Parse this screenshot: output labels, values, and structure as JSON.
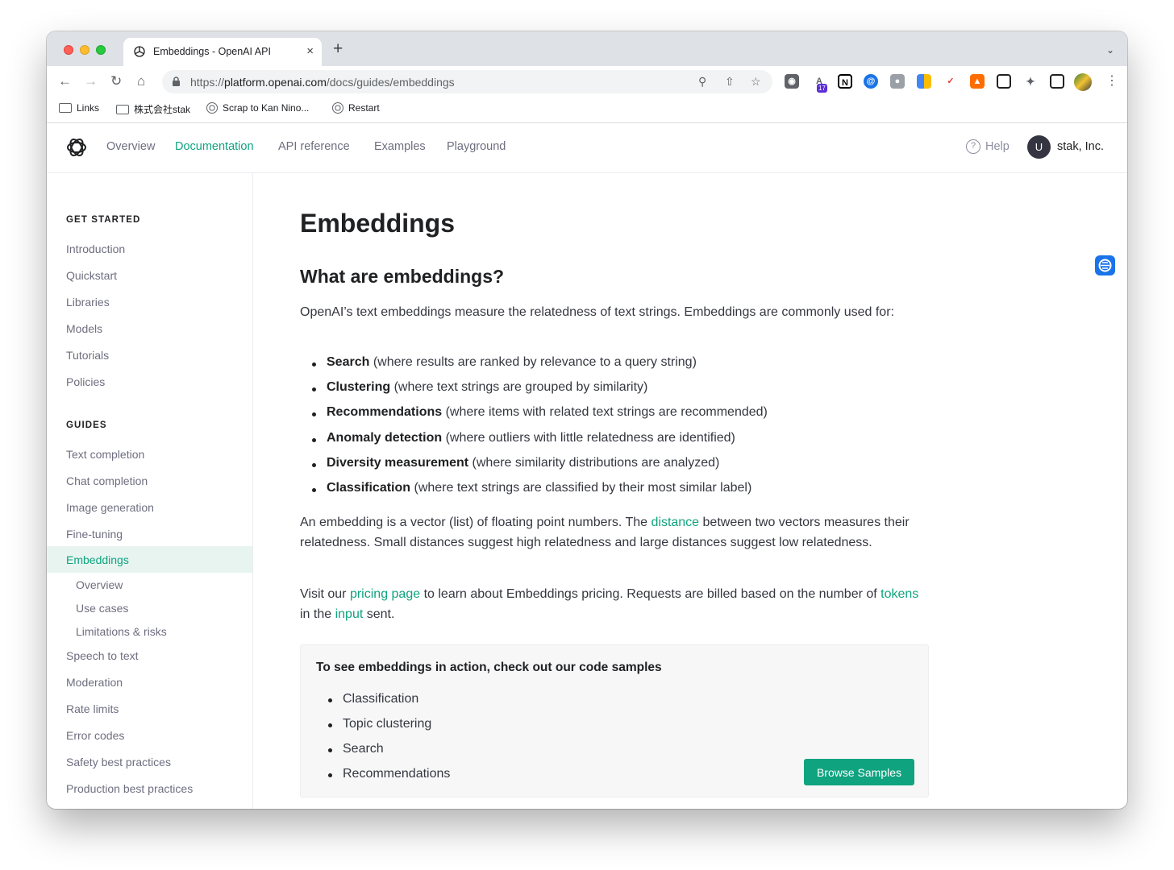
{
  "browser": {
    "tab_title": "Embeddings - OpenAI API",
    "tab_close": "×",
    "new_tab": "+",
    "url_prefix": "https://",
    "url_host": "platform.openai.com",
    "url_path": "/docs/guides/embeddings",
    "extension_badge": "17",
    "bookmarks": [
      "Links",
      "株式会社stak",
      "Scrap to Kan Nino...",
      "Restart"
    ]
  },
  "site": {
    "nav": [
      "Overview",
      "Documentation",
      "API reference",
      "Examples",
      "Playground"
    ],
    "active_nav": "Documentation",
    "help_label": "Help",
    "user_initial": "U",
    "org_name": "stak, Inc."
  },
  "sidebar": {
    "get_started_heading": "GET STARTED",
    "get_started": [
      "Introduction",
      "Quickstart",
      "Libraries",
      "Models",
      "Tutorials",
      "Policies"
    ],
    "guides_heading": "GUIDES",
    "guides": [
      "Text completion",
      "Chat completion",
      "Image generation",
      "Fine-tuning",
      "Embeddings"
    ],
    "embeddings_sub": [
      "Overview",
      "Use cases",
      "Limitations & risks"
    ],
    "guides_after": [
      "Speech to text",
      "Moderation",
      "Rate limits",
      "Error codes",
      "Safety best practices",
      "Production best practices"
    ]
  },
  "content": {
    "title": "Embeddings",
    "section_title": "What are embeddings?",
    "intro": "OpenAI’s text embeddings measure the relatedness of text strings. Embeddings are commonly used for:",
    "uses": [
      {
        "term": "Search",
        "desc": "(where results are ranked by relevance to a query string)"
      },
      {
        "term": "Clustering",
        "desc": "(where text strings are grouped by similarity)"
      },
      {
        "term": "Recommendations",
        "desc": "(where items with related text strings are recommended)"
      },
      {
        "term": "Anomaly detection",
        "desc": "(where outliers with little relatedness are identified)"
      },
      {
        "term": "Diversity measurement",
        "desc": "(where similarity distributions are analyzed)"
      },
      {
        "term": "Classification",
        "desc": "(where text strings are classified by their most similar label)"
      }
    ],
    "para2_a": "An embedding is a vector (list) of floating point numbers. The ",
    "para2_link": "distance",
    "para2_b": " between two vectors measures their relatedness. Small distances suggest high relatedness and large distances suggest low relatedness.",
    "para3_a": "Visit our ",
    "para3_link1": "pricing page",
    "para3_b": " to learn about Embeddings pricing. Requests are billed based on the number of ",
    "para3_link2": "tokens",
    "para3_c": " in the ",
    "para3_link3": "input",
    "para3_d": " sent.",
    "samples_title": "To see embeddings in action, check out our code samples",
    "samples": [
      "Classification",
      "Topic clustering",
      "Search",
      "Recommendations"
    ],
    "browse_button": "Browse Samples"
  },
  "colors": {
    "accent": "#10a37f",
    "text": "#353740",
    "muted": "#6e6e80"
  }
}
